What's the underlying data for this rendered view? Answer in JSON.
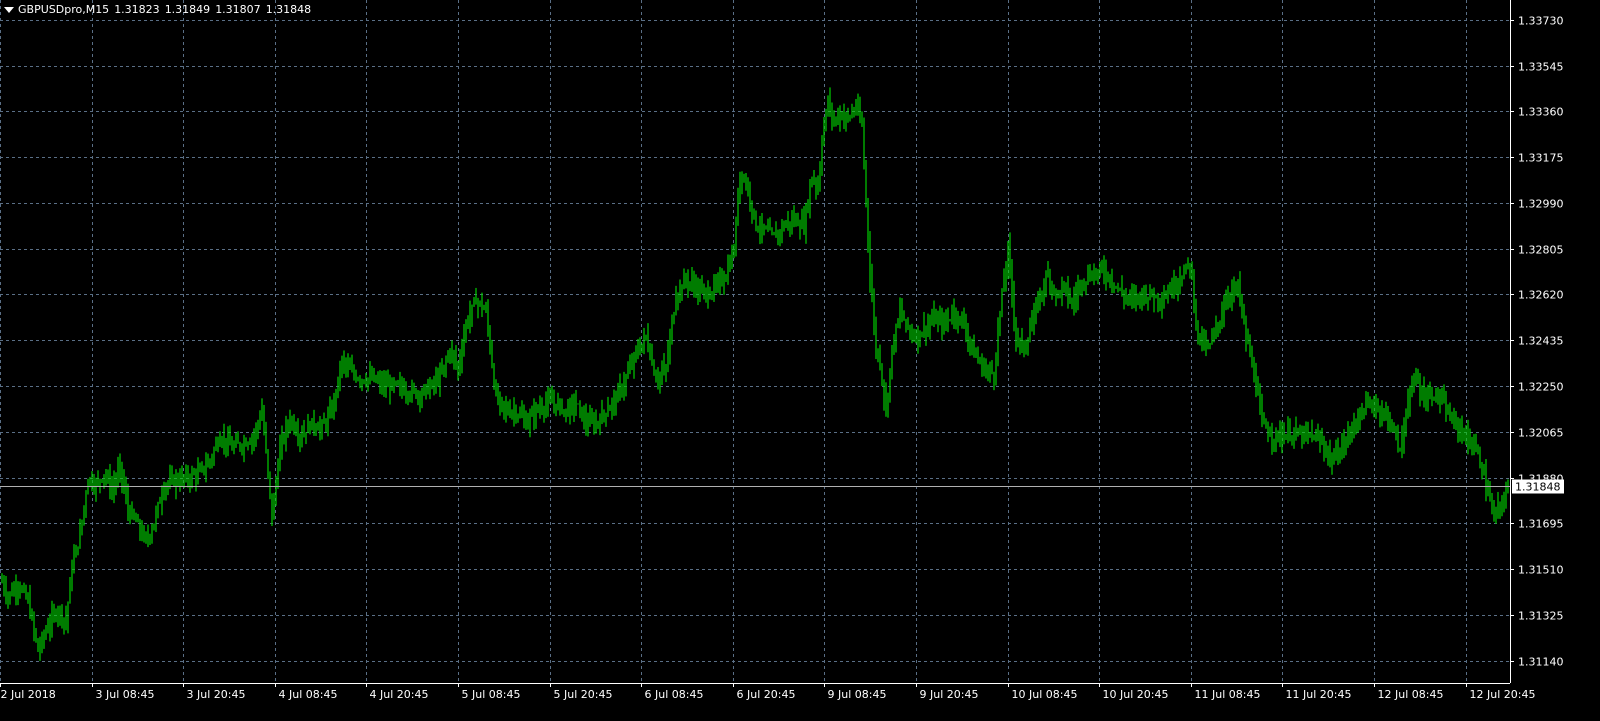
{
  "header": {
    "symbol": "GBPUSDpro,M15",
    "open": "1.31823",
    "high": "1.31849",
    "low": "1.31807",
    "close": "1.31848"
  },
  "colors": {
    "background": "#000000",
    "grid": "#5a6f86",
    "bars": "#00d000",
    "axis_text": "#ffffff",
    "price_line": "#b0b0b0"
  },
  "chart_data": {
    "type": "bar",
    "subtype": "ohlc",
    "ylim": [
      1.3105,
      1.3381
    ],
    "y_ticks": [
      "1.33730",
      "1.33545",
      "1.33360",
      "1.33175",
      "1.32990",
      "1.32805",
      "1.32620",
      "1.32435",
      "1.32250",
      "1.32065",
      "1.31880",
      "1.31695",
      "1.31510",
      "1.31325",
      "1.31140"
    ],
    "x_ticks": [
      "2 Jul 2018",
      "3 Jul 08:45",
      "3 Jul 20:45",
      "4 Jul 08:45",
      "4 Jul 20:45",
      "5 Jul 08:45",
      "5 Jul 20:45",
      "6 Jul 08:45",
      "6 Jul 20:45",
      "9 Jul 08:45",
      "9 Jul 20:45",
      "10 Jul 08:45",
      "10 Jul 20:45",
      "11 Jul 08:45",
      "11 Jul 20:45",
      "12 Jul 08:45",
      "12 Jul 20:45"
    ],
    "current_price": "1.31848",
    "grid": true,
    "path": [
      [
        0,
        1.3148
      ],
      [
        8,
        1.314
      ],
      [
        18,
        1.3145
      ],
      [
        28,
        1.3138
      ],
      [
        38,
        1.3118
      ],
      [
        48,
        1.3128
      ],
      [
        58,
        1.3135
      ],
      [
        66,
        1.313
      ],
      [
        72,
        1.3152
      ],
      [
        80,
        1.3165
      ],
      [
        88,
        1.3188
      ],
      [
        96,
        1.3185
      ],
      [
        104,
        1.319
      ],
      [
        112,
        1.3183
      ],
      [
        120,
        1.3192
      ],
      [
        128,
        1.3175
      ],
      [
        136,
        1.317
      ],
      [
        146,
        1.3162
      ],
      [
        154,
        1.317
      ],
      [
        164,
        1.3185
      ],
      [
        176,
        1.3187
      ],
      [
        188,
        1.3188
      ],
      [
        200,
        1.319
      ],
      [
        210,
        1.3195
      ],
      [
        220,
        1.3205
      ],
      [
        232,
        1.32
      ],
      [
        244,
        1.3202
      ],
      [
        254,
        1.3205
      ],
      [
        262,
        1.3215
      ],
      [
        272,
        1.3172
      ],
      [
        280,
        1.32
      ],
      [
        290,
        1.3212
      ],
      [
        300,
        1.3205
      ],
      [
        312,
        1.321
      ],
      [
        322,
        1.3208
      ],
      [
        332,
        1.3215
      ],
      [
        342,
        1.3235
      ],
      [
        352,
        1.323
      ],
      [
        362,
        1.3228
      ],
      [
        372,
        1.3228
      ],
      [
        384,
        1.3225
      ],
      [
        396,
        1.3225
      ],
      [
        408,
        1.3223
      ],
      [
        420,
        1.3222
      ],
      [
        432,
        1.3225
      ],
      [
        442,
        1.323
      ],
      [
        450,
        1.324
      ],
      [
        458,
        1.3232
      ],
      [
        466,
        1.325
      ],
      [
        476,
        1.326
      ],
      [
        486,
        1.3255
      ],
      [
        496,
        1.322
      ],
      [
        506,
        1.3215
      ],
      [
        516,
        1.3215
      ],
      [
        526,
        1.321
      ],
      [
        536,
        1.3215
      ],
      [
        546,
        1.3218
      ],
      [
        556,
        1.3218
      ],
      [
        566,
        1.3215
      ],
      [
        576,
        1.3218
      ],
      [
        586,
        1.321
      ],
      [
        596,
        1.321
      ],
      [
        606,
        1.3215
      ],
      [
        616,
        1.322
      ],
      [
        626,
        1.3228
      ],
      [
        636,
        1.3238
      ],
      [
        646,
        1.3245
      ],
      [
        656,
        1.3228
      ],
      [
        666,
        1.3232
      ],
      [
        676,
        1.3262
      ],
      [
        686,
        1.3268
      ],
      [
        696,
        1.3265
      ],
      [
        706,
        1.3262
      ],
      [
        716,
        1.3265
      ],
      [
        726,
        1.327
      ],
      [
        734,
        1.328
      ],
      [
        740,
        1.3312
      ],
      [
        748,
        1.3305
      ],
      [
        756,
        1.329
      ],
      [
        764,
        1.3288
      ],
      [
        774,
        1.3285
      ],
      [
        784,
        1.329
      ],
      [
        794,
        1.3292
      ],
      [
        804,
        1.329
      ],
      [
        812,
        1.331
      ],
      [
        818,
        1.3305
      ],
      [
        822,
        1.3325
      ],
      [
        828,
        1.334
      ],
      [
        834,
        1.3332
      ],
      [
        840,
        1.3335
      ],
      [
        848,
        1.3333
      ],
      [
        856,
        1.3338
      ],
      [
        862,
        1.333
      ],
      [
        866,
        1.33
      ],
      [
        870,
        1.327
      ],
      [
        876,
        1.324
      ],
      [
        880,
        1.3235
      ],
      [
        886,
        1.3215
      ],
      [
        892,
        1.324
      ],
      [
        900,
        1.3255
      ],
      [
        906,
        1.325
      ],
      [
        914,
        1.3245
      ],
      [
        924,
        1.3248
      ],
      [
        934,
        1.3252
      ],
      [
        944,
        1.325
      ],
      [
        954,
        1.3255
      ],
      [
        964,
        1.325
      ],
      [
        974,
        1.3238
      ],
      [
        984,
        1.3232
      ],
      [
        994,
        1.323
      ],
      [
        1000,
        1.3255
      ],
      [
        1008,
        1.328
      ],
      [
        1016,
        1.3245
      ],
      [
        1024,
        1.324
      ],
      [
        1032,
        1.325
      ],
      [
        1040,
        1.3262
      ],
      [
        1048,
        1.327
      ],
      [
        1056,
        1.3262
      ],
      [
        1064,
        1.3265
      ],
      [
        1072,
        1.3258
      ],
      [
        1082,
        1.3268
      ],
      [
        1092,
        1.327
      ],
      [
        1102,
        1.3272
      ],
      [
        1112,
        1.3268
      ],
      [
        1122,
        1.3262
      ],
      [
        1132,
        1.326
      ],
      [
        1142,
        1.3262
      ],
      [
        1152,
        1.3262
      ],
      [
        1162,
        1.326
      ],
      [
        1172,
        1.3265
      ],
      [
        1182,
        1.327
      ],
      [
        1190,
        1.3275
      ],
      [
        1198,
        1.3245
      ],
      [
        1208,
        1.324
      ],
      [
        1218,
        1.325
      ],
      [
        1228,
        1.3262
      ],
      [
        1238,
        1.3265
      ],
      [
        1246,
        1.3245
      ],
      [
        1254,
        1.323
      ],
      [
        1262,
        1.321
      ],
      [
        1272,
        1.3205
      ],
      [
        1282,
        1.3205
      ],
      [
        1292,
        1.3206
      ],
      [
        1302,
        1.3205
      ],
      [
        1312,
        1.3205
      ],
      [
        1322,
        1.3202
      ],
      [
        1332,
        1.3195
      ],
      [
        1342,
        1.32
      ],
      [
        1352,
        1.3208
      ],
      [
        1362,
        1.3215
      ],
      [
        1372,
        1.3218
      ],
      [
        1382,
        1.3215
      ],
      [
        1392,
        1.321
      ],
      [
        1400,
        1.3198
      ],
      [
        1408,
        1.322
      ],
      [
        1416,
        1.3228
      ],
      [
        1424,
        1.322
      ],
      [
        1432,
        1.3222
      ],
      [
        1440,
        1.322
      ],
      [
        1450,
        1.3212
      ],
      [
        1460,
        1.3208
      ],
      [
        1470,
        1.3202
      ],
      [
        1478,
        1.3198
      ],
      [
        1486,
        1.3185
      ],
      [
        1494,
        1.3172
      ],
      [
        1502,
        1.3178
      ],
      [
        1508,
        1.3184
      ]
    ]
  }
}
